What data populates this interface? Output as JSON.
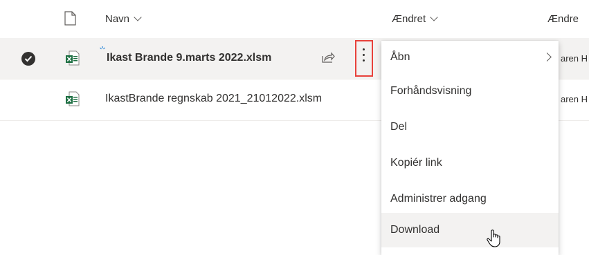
{
  "header": {
    "name_label": "Navn",
    "modified_label": "Ændret",
    "modified_by_label": "Ændre"
  },
  "files": [
    {
      "name": "Ikast Brande 9.marts 2022.xlsm",
      "selected": true,
      "modified_by": "aren H"
    },
    {
      "name": "IkastBrande regnskab 2021_21012022.xlsm",
      "selected": false,
      "modified_by": "aren H"
    }
  ],
  "context_menu": {
    "items": [
      {
        "label": "Åbn",
        "has_submenu": true
      },
      {
        "label": "Forhåndsvisning"
      },
      {
        "label": "Del"
      },
      {
        "label": "Kopiér link"
      },
      {
        "label": "Administrer adgang"
      },
      {
        "label": "Download",
        "hovered": true
      }
    ]
  },
  "colors": {
    "selected_row_bg": "#f3f2f1",
    "excel_green": "#1d6f42",
    "highlight_box": "#e8413b"
  }
}
